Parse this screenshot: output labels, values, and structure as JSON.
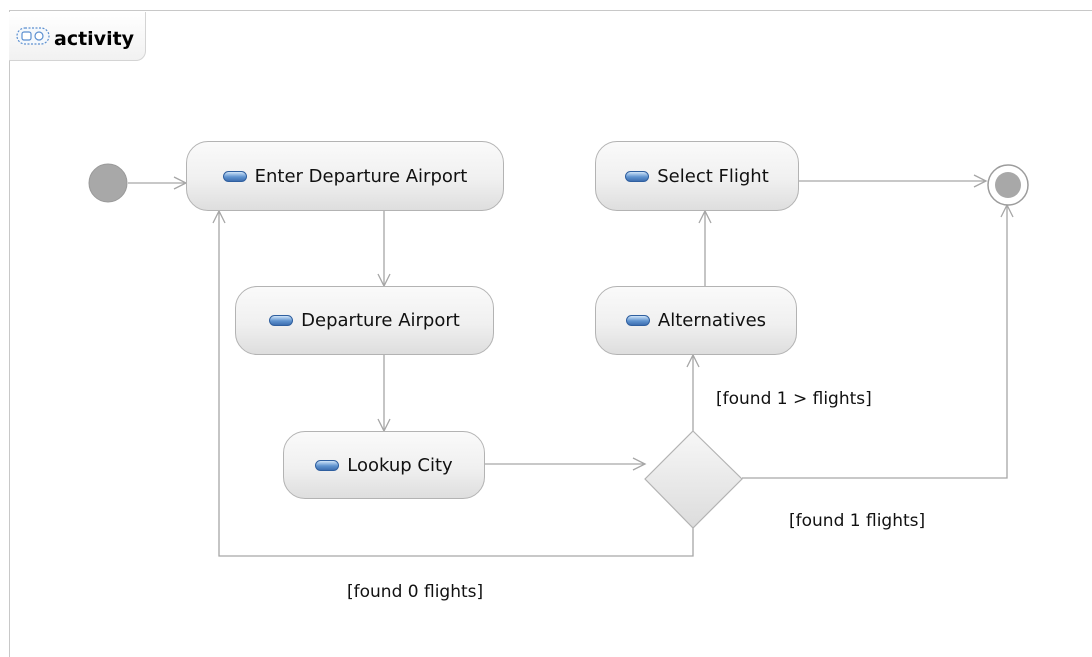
{
  "diagram": {
    "tab_label": "activity",
    "tab_icon": "activity-diagram-icon",
    "actions": [
      {
        "label": "Enter Departure Airport",
        "icon": "action-icon"
      },
      {
        "label": "Departure Airport",
        "icon": "action-icon"
      },
      {
        "label": "Lookup City",
        "icon": "action-icon"
      },
      {
        "label": "Alternatives",
        "icon": "action-icon"
      },
      {
        "label": "Select Flight",
        "icon": "action-icon"
      }
    ],
    "guards": {
      "many": "[found 1 > flights]",
      "one": "[found 1 flights]",
      "zero": "[found 0 flights]"
    },
    "colors": {
      "edge": "#a6a6a6",
      "node_border": "#b3b3b3",
      "initial": "#a8a8a8",
      "action_pill": "#5f93cf"
    }
  }
}
